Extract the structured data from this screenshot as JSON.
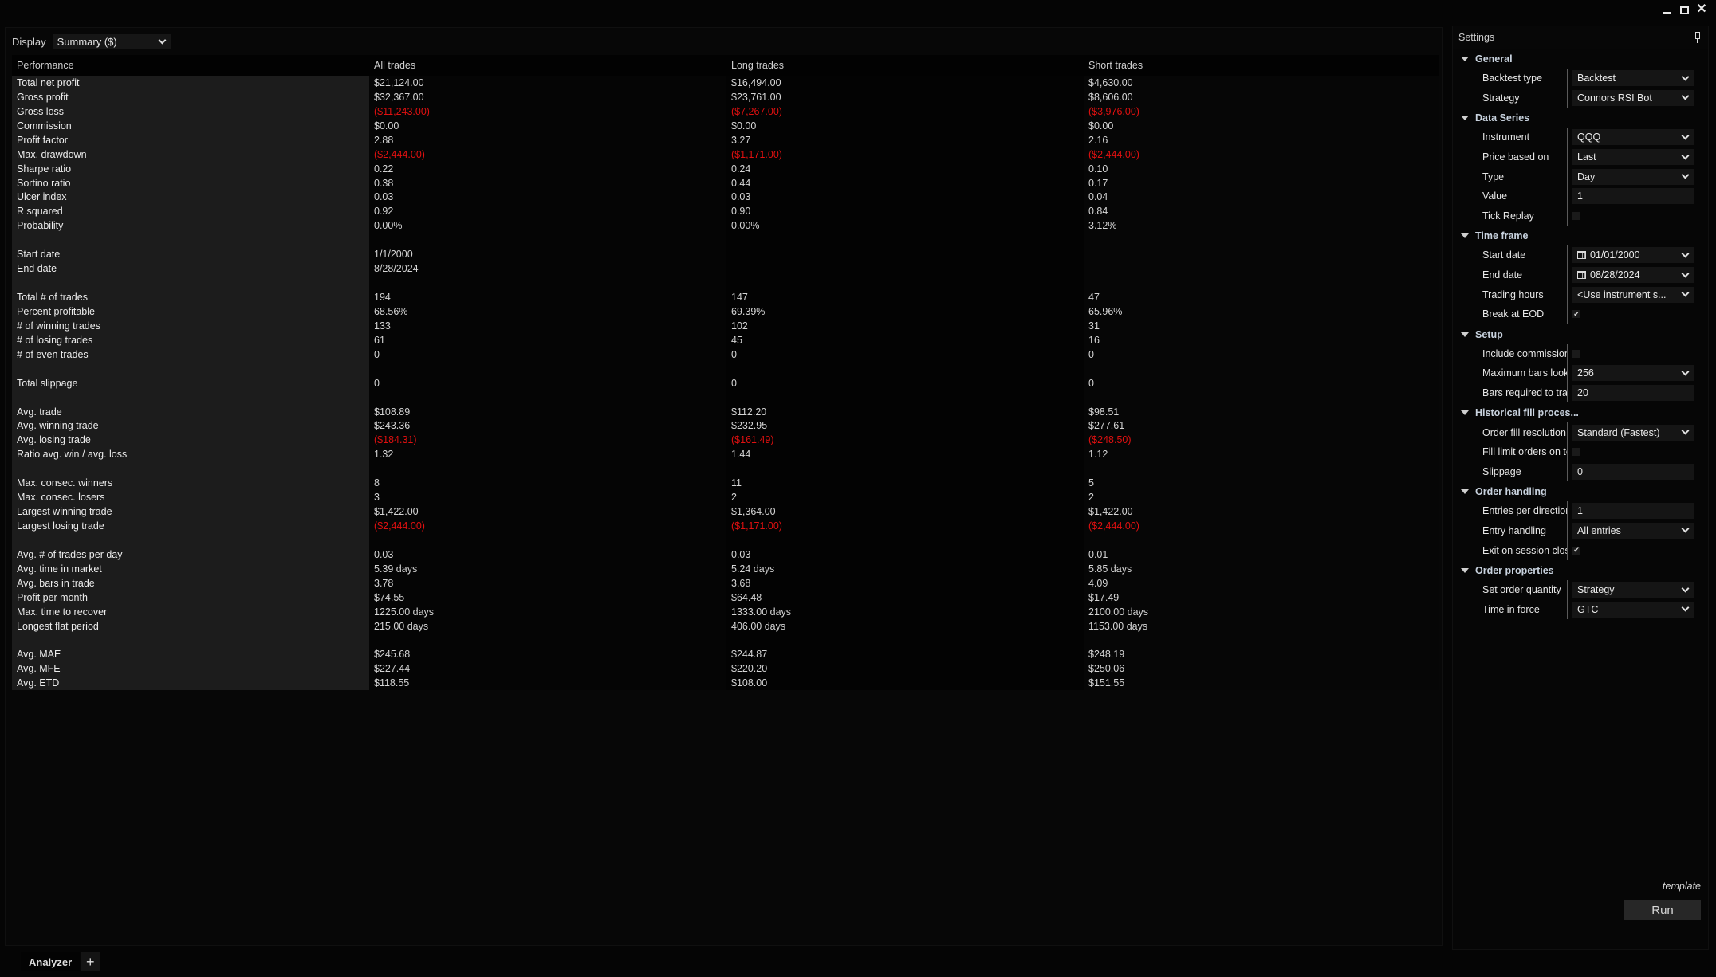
{
  "window": {
    "minimize": "minimize",
    "maximize": "maximize",
    "close": "close"
  },
  "display": {
    "label": "Display",
    "selected": "Summary ($)"
  },
  "table": {
    "headers": [
      "Performance",
      "All trades",
      "Long trades",
      "Short trades"
    ],
    "rows": [
      {
        "label": "Total net profit",
        "all": "$21,124.00",
        "long": "$16,494.00",
        "short": "$4,630.00"
      },
      {
        "label": "Gross profit",
        "all": "$32,367.00",
        "long": "$23,761.00",
        "short": "$8,606.00"
      },
      {
        "label": "Gross loss",
        "all": "($11,243.00)",
        "long": "($7,267.00)",
        "short": "($3,976.00)",
        "negative": true
      },
      {
        "label": "Commission",
        "all": "$0.00",
        "long": "$0.00",
        "short": "$0.00"
      },
      {
        "label": "Profit factor",
        "all": "2.88",
        "long": "3.27",
        "short": "2.16"
      },
      {
        "label": "Max. drawdown",
        "all": "($2,444.00)",
        "long": "($1,171.00)",
        "short": "($2,444.00)",
        "negative": true
      },
      {
        "label": "Sharpe ratio",
        "all": "0.22",
        "long": "0.24",
        "short": "0.10"
      },
      {
        "label": "Sortino ratio",
        "all": "0.38",
        "long": "0.44",
        "short": "0.17"
      },
      {
        "label": "Ulcer index",
        "all": "0.03",
        "long": "0.03",
        "short": "0.04"
      },
      {
        "label": "R squared",
        "all": "0.92",
        "long": "0.90",
        "short": "0.84"
      },
      {
        "label": "Probability",
        "all": "0.00%",
        "long": "0.00%",
        "short": "3.12%"
      },
      {
        "label": "",
        "all": "",
        "long": "",
        "short": ""
      },
      {
        "label": "Start date",
        "all": "1/1/2000",
        "long": "",
        "short": ""
      },
      {
        "label": "End date",
        "all": "8/28/2024",
        "long": "",
        "short": ""
      },
      {
        "label": "",
        "all": "",
        "long": "",
        "short": ""
      },
      {
        "label": "Total # of trades",
        "all": "194",
        "long": "147",
        "short": "47"
      },
      {
        "label": "Percent profitable",
        "all": "68.56%",
        "long": "69.39%",
        "short": "65.96%"
      },
      {
        "label": "# of winning trades",
        "all": "133",
        "long": "102",
        "short": "31"
      },
      {
        "label": "# of losing trades",
        "all": "61",
        "long": "45",
        "short": "16"
      },
      {
        "label": "# of even trades",
        "all": "0",
        "long": "0",
        "short": "0"
      },
      {
        "label": "",
        "all": "",
        "long": "",
        "short": ""
      },
      {
        "label": "Total slippage",
        "all": "0",
        "long": "0",
        "short": "0"
      },
      {
        "label": "",
        "all": "",
        "long": "",
        "short": ""
      },
      {
        "label": "Avg. trade",
        "all": "$108.89",
        "long": "$112.20",
        "short": "$98.51"
      },
      {
        "label": "Avg. winning trade",
        "all": "$243.36",
        "long": "$232.95",
        "short": "$277.61"
      },
      {
        "label": "Avg. losing trade",
        "all": "($184.31)",
        "long": "($161.49)",
        "short": "($248.50)",
        "negative": true
      },
      {
        "label": "Ratio avg. win / avg. loss",
        "all": "1.32",
        "long": "1.44",
        "short": "1.12"
      },
      {
        "label": "",
        "all": "",
        "long": "",
        "short": ""
      },
      {
        "label": "Max. consec. winners",
        "all": "8",
        "long": "11",
        "short": "5"
      },
      {
        "label": "Max. consec. losers",
        "all": "3",
        "long": "2",
        "short": "2"
      },
      {
        "label": "Largest winning trade",
        "all": "$1,422.00",
        "long": "$1,364.00",
        "short": "$1,422.00"
      },
      {
        "label": "Largest losing trade",
        "all": "($2,444.00)",
        "long": "($1,171.00)",
        "short": "($2,444.00)",
        "negative": true
      },
      {
        "label": "",
        "all": "",
        "long": "",
        "short": ""
      },
      {
        "label": "Avg. # of trades per day",
        "all": "0.03",
        "long": "0.03",
        "short": "0.01"
      },
      {
        "label": "Avg. time in market",
        "all": "5.39 days",
        "long": "5.24 days",
        "short": "5.85 days"
      },
      {
        "label": "Avg. bars in trade",
        "all": "3.78",
        "long": "3.68",
        "short": "4.09"
      },
      {
        "label": "Profit per month",
        "all": "$74.55",
        "long": "$64.48",
        "short": "$17.49"
      },
      {
        "label": "Max. time to recover",
        "all": "1225.00 days",
        "long": "1333.00 days",
        "short": "2100.00 days"
      },
      {
        "label": "Longest flat period",
        "all": "215.00 days",
        "long": "406.00 days",
        "short": "1153.00 days"
      },
      {
        "label": "",
        "all": "",
        "long": "",
        "short": ""
      },
      {
        "label": "Avg. MAE",
        "all": "$245.68",
        "long": "$244.87",
        "short": "$248.19"
      },
      {
        "label": "Avg. MFE",
        "all": "$227.44",
        "long": "$220.20",
        "short": "$250.06"
      },
      {
        "label": "Avg. ETD",
        "all": "$118.55",
        "long": "$108.00",
        "short": "$151.55"
      }
    ]
  },
  "tabs": {
    "active": "Analyzer",
    "add": "+"
  },
  "settings": {
    "title": "Settings",
    "groups": [
      {
        "name": "General",
        "props": [
          {
            "label": "Backtest type",
            "type": "select",
            "value": "Backtest"
          },
          {
            "label": "Strategy",
            "type": "select",
            "value": "Connors RSI Bot"
          }
        ]
      },
      {
        "name": "Data Series",
        "props": [
          {
            "label": "Instrument",
            "type": "select",
            "value": "QQQ"
          },
          {
            "label": "Price based on",
            "type": "select",
            "value": "Last"
          },
          {
            "label": "Type",
            "type": "select",
            "value": "Day"
          },
          {
            "label": "Value",
            "type": "text",
            "value": "1"
          },
          {
            "label": "Tick Replay",
            "type": "check",
            "value": false
          }
        ]
      },
      {
        "name": "Time frame",
        "props": [
          {
            "label": "Start date",
            "type": "date",
            "value": "01/01/2000"
          },
          {
            "label": "End date",
            "type": "date",
            "value": "08/28/2024"
          },
          {
            "label": "Trading hours",
            "type": "select",
            "value": "<Use instrument s..."
          },
          {
            "label": "Break at EOD",
            "type": "check",
            "value": true
          }
        ]
      },
      {
        "name": "Setup",
        "props": [
          {
            "label": "Include commission",
            "type": "check",
            "value": false
          },
          {
            "label": "Maximum bars look...",
            "type": "select",
            "value": "256"
          },
          {
            "label": "Bars required to trade",
            "type": "text",
            "value": "20"
          }
        ]
      },
      {
        "name": "Historical fill proces...",
        "props": [
          {
            "label": "Order fill resolution",
            "type": "select",
            "value": "Standard (Fastest)"
          },
          {
            "label": "Fill limit orders on to...",
            "type": "check",
            "value": false
          },
          {
            "label": "Slippage",
            "type": "text",
            "value": "0"
          }
        ]
      },
      {
        "name": "Order handling",
        "props": [
          {
            "label": "Entries per direction",
            "type": "text",
            "value": "1"
          },
          {
            "label": "Entry handling",
            "type": "select",
            "value": "All entries"
          },
          {
            "label": "Exit on session close",
            "type": "check",
            "value": true
          }
        ]
      },
      {
        "name": "Order properties",
        "props": [
          {
            "label": "Set order quantity",
            "type": "select",
            "value": "Strategy"
          },
          {
            "label": "Time in force",
            "type": "select",
            "value": "GTC"
          }
        ]
      }
    ],
    "template_label": "template",
    "run_label": "Run"
  },
  "colors": {
    "negative": "#e01010",
    "label_column_bg": "#1c1c1c",
    "group_header": "#c8d2de"
  }
}
